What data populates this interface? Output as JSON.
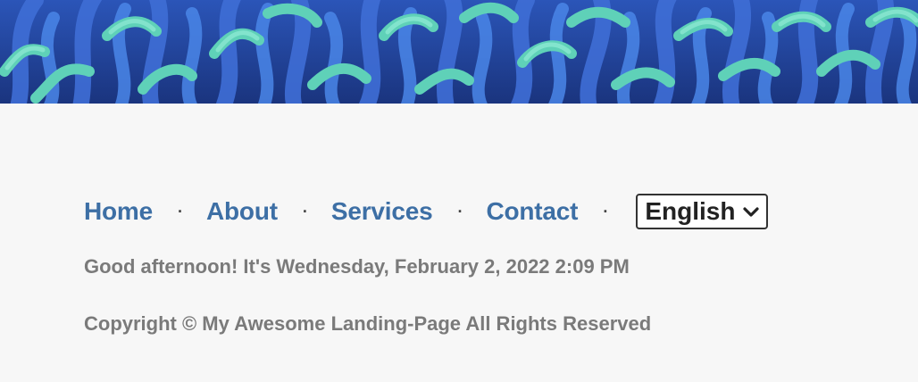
{
  "hero": {
    "colors": {
      "background": "#1f3d8a",
      "tentacle_blue": "#3e6fd6",
      "tentacle_teal": "#5fd1b8",
      "tentacle_light": "#8be8d2"
    }
  },
  "nav": {
    "items": [
      {
        "label": "Home"
      },
      {
        "label": "About"
      },
      {
        "label": "Services"
      },
      {
        "label": "Contact"
      }
    ],
    "separator": "·",
    "link_color": "#3d6fa5"
  },
  "language_select": {
    "selected": "English",
    "icon": "chevron-down-icon"
  },
  "greeting": "Good afternoon! It's Wednesday, February 2, 2022 2:09 PM",
  "copyright": "Copyright © My Awesome Landing-Page All Rights Reserved"
}
